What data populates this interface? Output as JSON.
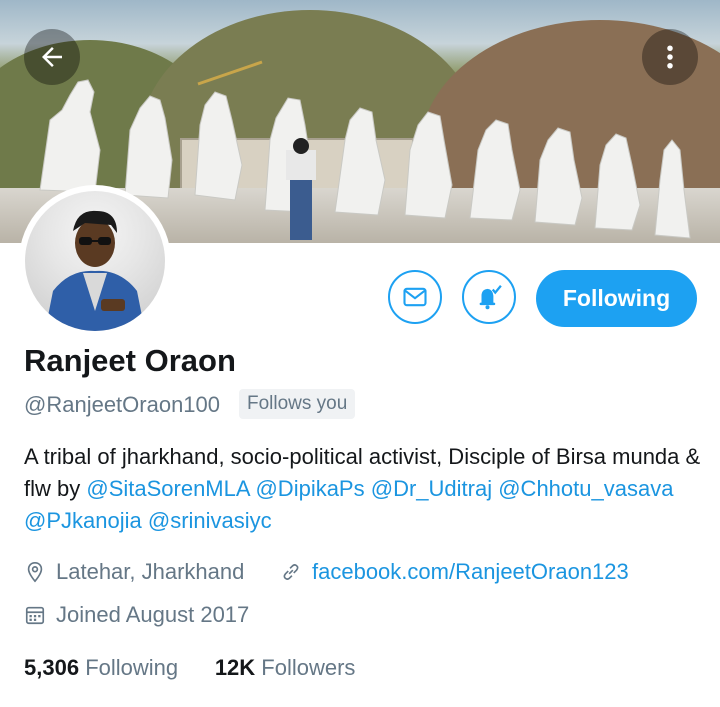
{
  "header": {
    "back_icon": "arrow-left-icon",
    "more_icon": "more-vertical-icon"
  },
  "profile": {
    "name": "Ranjeet Oraon",
    "handle": "@RanjeetOraon100",
    "follows_you": "Follows you",
    "bio_prefix": "A tribal of jharkhand, socio-political activist, Disciple of Birsa munda & flw by ",
    "mentions": [
      "@SitaSorenMLA",
      "@DipikaPs",
      "@Dr_Uditraj",
      "@Chhotu_vasava",
      "@PJkanojia",
      "@srinivasiyc"
    ],
    "location": "Latehar, Jharkhand",
    "website": "facebook.com/RanjeetOraon123",
    "joined": "Joined August 2017",
    "following_count": "5,306",
    "following_label": "Following",
    "followers_count": "12K",
    "followers_label": "Followers"
  },
  "actions": {
    "message_icon": "envelope-icon",
    "notify_icon": "bell-check-icon",
    "follow_label": "Following"
  },
  "colors": {
    "accent": "#1da1f2",
    "link": "#1b95e0",
    "secondary_text": "#657786"
  }
}
